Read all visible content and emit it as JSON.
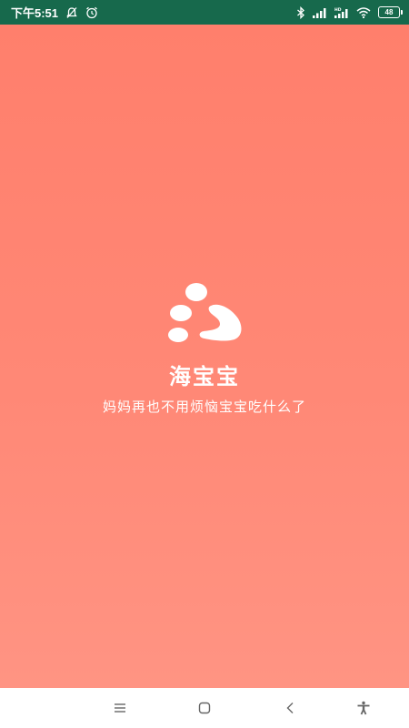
{
  "status_bar": {
    "time": "下午5:51",
    "left_icons": [
      "notifications-off-icon",
      "alarm-icon"
    ],
    "right_icons": [
      "bluetooth-icon",
      "signal-icon",
      "hd-signal-icon",
      "wifi-icon"
    ],
    "battery_level": "48",
    "background_color": "#17694c"
  },
  "splash": {
    "app_name": "海宝宝",
    "tagline": "妈妈再也不用烦恼宝宝吃什么了",
    "logo_icon": "app-logo-icon",
    "background_color": "#ff8473"
  },
  "nav_bar": {
    "buttons": [
      "menu-icon",
      "home-icon",
      "back-icon",
      "accessibility-icon"
    ]
  }
}
